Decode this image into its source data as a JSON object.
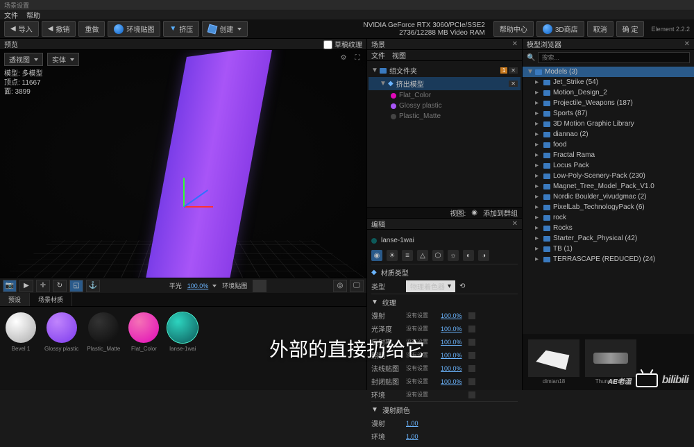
{
  "title": "场景设置",
  "menu": {
    "file": "文件",
    "help": "帮助"
  },
  "gpu": {
    "line1": "NVIDIA GeForce RTX 3060/PCIe/SSE2",
    "line2": "2736/12288 MB Video RAM"
  },
  "app_version": "Element  2.2.2",
  "toolbar": {
    "import": "导入",
    "undo": "撤销",
    "redo": "重做",
    "env": "环境贴图",
    "extrude": "挤压",
    "create": "创建",
    "help_center": "帮助中心",
    "store": "3D商店",
    "cancel": "取消",
    "ok": "确 定"
  },
  "viewport": {
    "header": "预览",
    "checkbox_label": "草稿纹理",
    "camera_select": "透视图",
    "camera_alt": "实体",
    "stats": {
      "l1": "模型: 多模型",
      "l2": "顶点: 11667",
      "l3": "面: 3899"
    },
    "bottom": {
      "label1": "平光",
      "value1": "100.0%",
      "label2": "环境贴图"
    }
  },
  "tabs": {
    "preset": "预设",
    "scene_mat": "场景材质"
  },
  "materials": [
    {
      "key": "white",
      "name": "Bevel 1"
    },
    {
      "key": "purple",
      "name": "Glossy plastic"
    },
    {
      "key": "black",
      "name": "Plastic_Matte"
    },
    {
      "key": "magenta",
      "name": "Flat_Color"
    },
    {
      "key": "teal",
      "name": "lanse-1wai"
    }
  ],
  "scene": {
    "header": "场景",
    "tabs": {
      "file": "文件",
      "view": "视图"
    },
    "root": "组文件夹",
    "extrude_node": "挤出模型",
    "children": [
      "Flat_Color",
      "Glossy plastic",
      "Plastic_Matte"
    ],
    "mid_bar": {
      "view": "视图:",
      "add_group": "添加到群组"
    },
    "edit_header": "编辑",
    "current": "lanse-1wai",
    "mat_type_label": "材质类型",
    "type_label": "类型",
    "type_value": "物理着色器",
    "texture_section": "纹理",
    "props": [
      {
        "label": "漫射",
        "status": "没有设置",
        "value": "100.0%"
      },
      {
        "label": "光泽度",
        "status": "没有设置",
        "value": "100.0%"
      },
      {
        "label": "反射率",
        "status": "没有设置",
        "value": "100.0%"
      },
      {
        "label": "照明",
        "status": "没有设置",
        "value": "100.0%"
      },
      {
        "label": "法线贴图",
        "status": "没有设置",
        "value": "100.0%"
      },
      {
        "label": "封闭贴图",
        "status": "没有设置",
        "value": "100.0%"
      },
      {
        "label": "环境",
        "status": "没有设置",
        "value": ""
      }
    ],
    "color_section": "漫射颜色",
    "color_props": [
      {
        "label": "漫射",
        "value": "1.00"
      },
      {
        "label": "环境",
        "value": "1.00"
      }
    ]
  },
  "browser": {
    "header": "模型浏览器",
    "search_placeholder": "搜索...",
    "root": "Models (3)",
    "items": [
      "Jet_Strike (54)",
      "Motion_Design_2",
      "Projectile_Weapons (187)",
      "Sports (87)",
      "3D Motion Graphic Library",
      "diannao (2)",
      "food",
      "Fractal Rama",
      "Locus Pack",
      "Low-Poly-Scenery-Pack (230)",
      "Magnet_Tree_Model_Pack_V1.0",
      "Nordic Boulder_vivudgmac (2)",
      "PixelLab_TechnologyPack (6)",
      "rock",
      "Rocks",
      "Starter_Pack_Physical (42)",
      "TB (1)",
      "TERRASCAPE (REDUCED) (24)"
    ],
    "thumbs": [
      {
        "name": "dimian18"
      },
      {
        "name": "Thunderbike"
      }
    ]
  },
  "subtitle": "外部的直接扔给它",
  "watermark": "AE老温"
}
